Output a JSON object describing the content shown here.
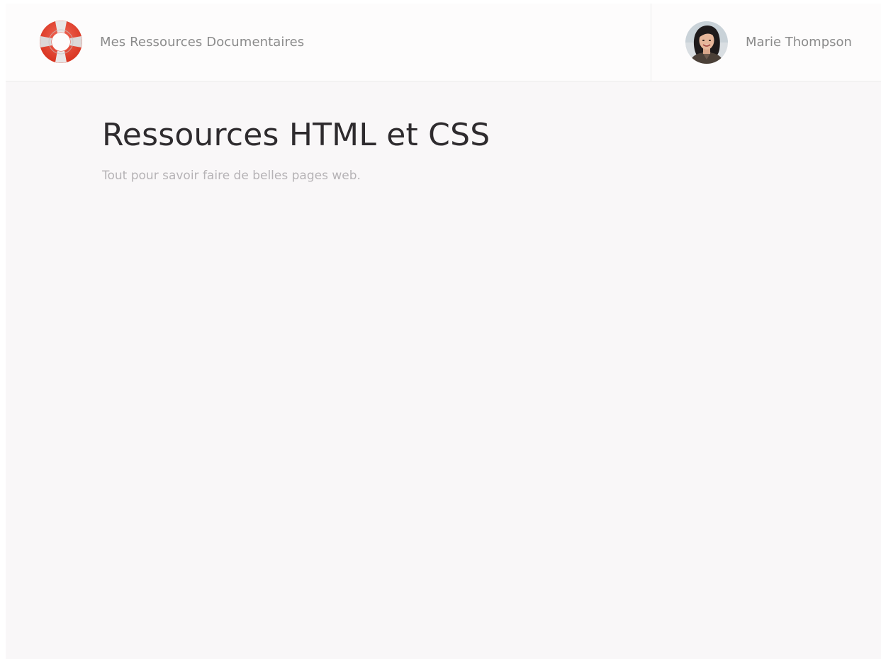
{
  "header": {
    "site_title": "Mes Ressources Documentaires",
    "logo_icon": "lifebuoy-icon",
    "user": {
      "name": "Marie Thompson",
      "avatar_icon": "user-avatar"
    }
  },
  "main": {
    "title": "Ressources HTML et CSS",
    "subtitle": "Tout pour savoir faire de belles pages web."
  },
  "colors": {
    "lifebuoy_red": "#e4402f",
    "background": "#f9f7f8",
    "header_background": "#fdfcfc",
    "muted_text": "#8b8b8b",
    "title_text": "#2e2b2e"
  }
}
